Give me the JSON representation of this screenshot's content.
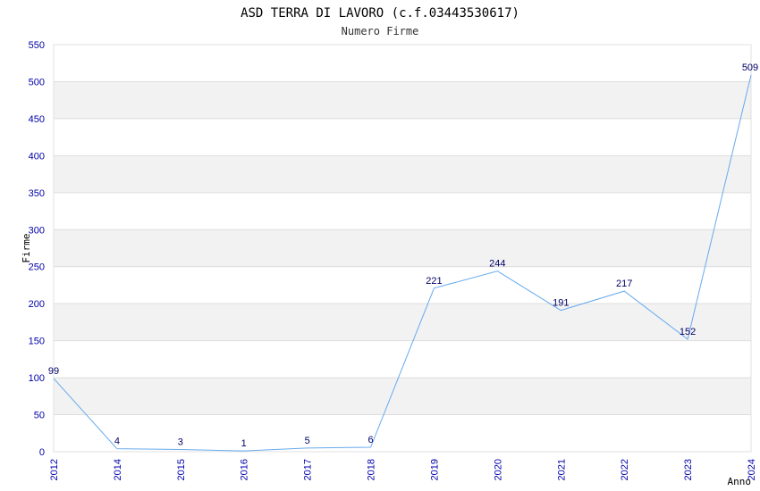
{
  "chart_data": {
    "type": "line",
    "title": "ASD TERRA DI LAVORO (c.f.03443530617)",
    "subtitle": "Numero Firme",
    "xlabel": "Anno",
    "ylabel": "Firme",
    "categories": [
      "2012",
      "2014",
      "2015",
      "2016",
      "2017",
      "2018",
      "2019",
      "2020",
      "2021",
      "2022",
      "2023",
      "2024"
    ],
    "values": [
      99,
      4,
      3,
      1,
      5,
      6,
      221,
      244,
      191,
      217,
      152,
      509
    ],
    "ylim": [
      0,
      550
    ],
    "yticks": [
      0,
      50,
      100,
      150,
      200,
      250,
      300,
      350,
      400,
      450,
      500,
      550
    ],
    "grid": true,
    "line_color": "#66aaee",
    "band_color": "#f2f2f2",
    "tick_color": "#0000aa",
    "label_color": "#000066"
  }
}
